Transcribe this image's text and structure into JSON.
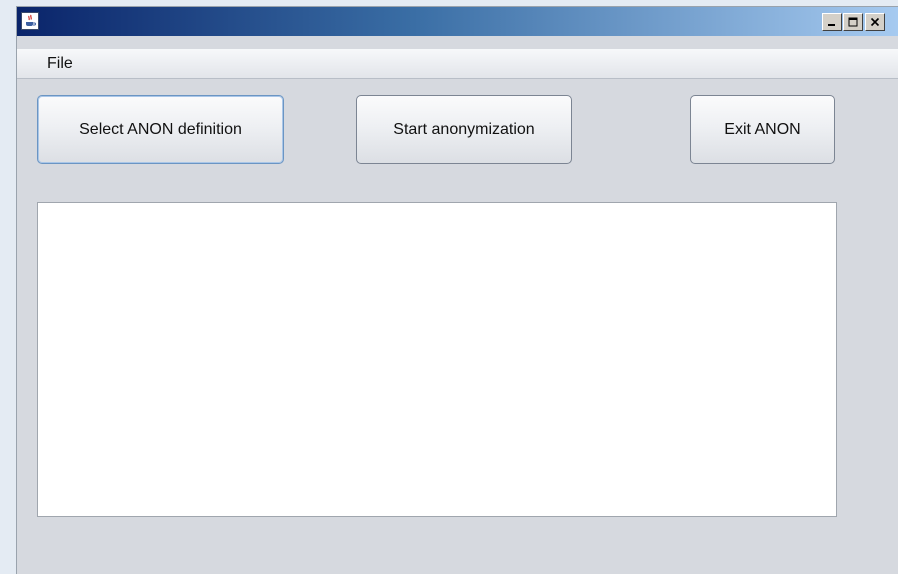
{
  "window": {
    "icon": "java-cup-icon",
    "controls": [
      "minimize-icon",
      "maximize-icon",
      "close-icon"
    ]
  },
  "menubar": {
    "items": [
      {
        "label": "File"
      }
    ]
  },
  "toolbar": {
    "select_label": "Select ANON definition",
    "start_label": "Start anonymization",
    "exit_label": "Exit ANON"
  },
  "log": {
    "content": ""
  }
}
